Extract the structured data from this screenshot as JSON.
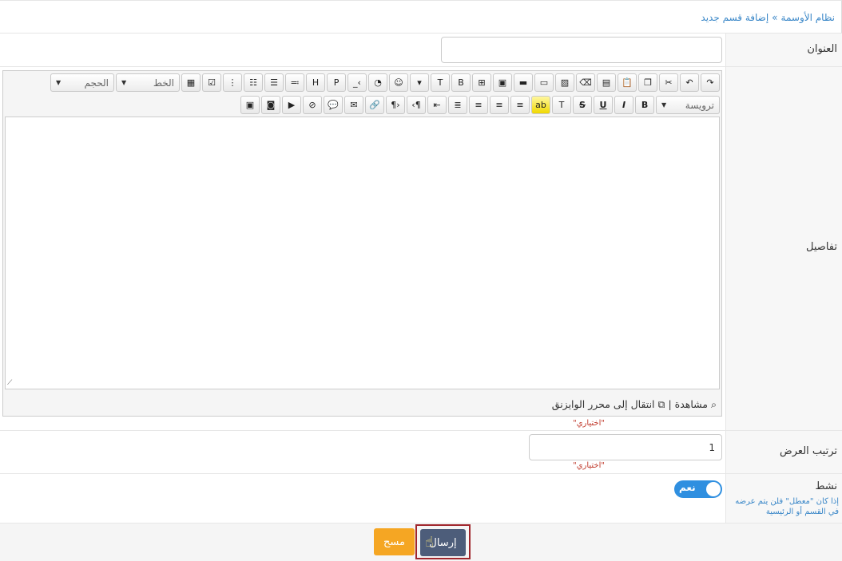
{
  "breadcrumb": {
    "root": "نظام الأوسمة",
    "separator": "»",
    "current": "إضافة قسم جديد"
  },
  "form": {
    "title": {
      "label": "العنوان",
      "value": ""
    },
    "details": {
      "label": "تفاصيل",
      "toolbar": {
        "font_size_select": "الحجم",
        "font_family_select": "الخط",
        "heading_select": "ترويسة"
      },
      "footer": {
        "preview": "مشاهدة",
        "divider": "|",
        "switch_editor": "انتقال إلى محرر الوايزنق"
      },
      "optional": "\"اختياري\""
    },
    "display_order": {
      "label": "ترتيب العرض",
      "value": "1",
      "optional": "\"اختياري\""
    },
    "active": {
      "label": "نشط",
      "toggle_label": "نعم",
      "help": "إذا كان \"معطل\" فلن يتم عرضه في القسم أو الرئيسية",
      "state": "on"
    }
  },
  "actions": {
    "submit_label": "إرسال",
    "clear_label": "مسح"
  },
  "colors": {
    "link": "#3a87c8",
    "toggle": "#2f8fe0",
    "submit": "#4d5d7a",
    "clear": "#f5a623",
    "optional_text": "#c0392b"
  }
}
